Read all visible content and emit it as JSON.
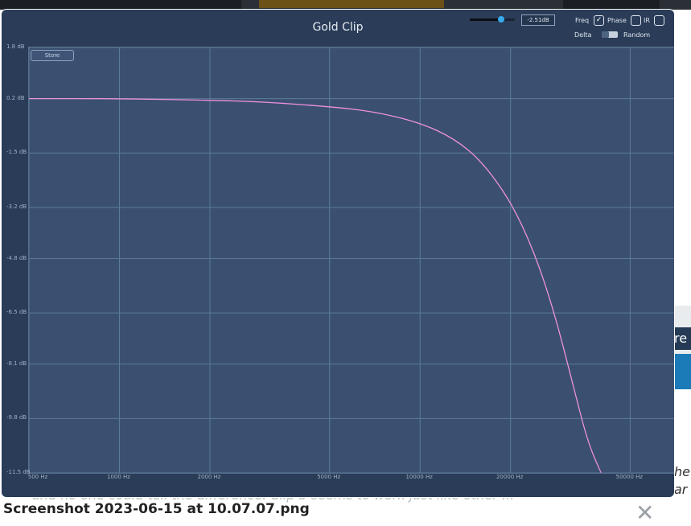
{
  "plugin": {
    "title": "Gold Clip",
    "gain_value": "-2.51dB",
    "store_label": "Store",
    "freq_label": "Freq",
    "freq_checked": true,
    "phase_label": "Phase",
    "phase_checked": false,
    "ir_label": "IR",
    "ir_checked": false,
    "delta_label": "Delta",
    "random_label": "Random",
    "check_glyph": "✓"
  },
  "chart_data": {
    "type": "line",
    "title": "Gold Clip",
    "xscale": "log",
    "xlim": [
      500,
      70000
    ],
    "ylim": [
      -11.5,
      1.8
    ],
    "grid": true,
    "y_tick_labels": [
      "1.8 dB",
      "0.2 dB",
      "-1.5 dB",
      "-3.2 dB",
      "-4.8 dB",
      "-6.5 dB",
      "-8.1 dB",
      "-9.8 dB",
      "-11.5 dB"
    ],
    "y_ticks": [
      1.8,
      0.2,
      -1.5,
      -3.2,
      -4.8,
      -6.5,
      -8.1,
      -9.8,
      -11.5
    ],
    "x_tick_labels": [
      "500 Hz",
      "1000 Hz",
      "2000 Hz",
      "5000 Hz",
      "10000 Hz",
      "20000 Hz",
      "50000 Hz"
    ],
    "x_ticks": [
      500,
      1000,
      2000,
      5000,
      10000,
      20000,
      50000
    ],
    "series": [
      {
        "color": "#ee90e0",
        "x": [
          500,
          1000,
          2000,
          3000,
          5000,
          7000,
          10000,
          13000,
          16000,
          20000,
          24000,
          28000,
          32000,
          36000,
          40000
        ],
        "y": [
          0.2,
          0.2,
          0.15,
          0.1,
          -0.05,
          -0.2,
          -0.55,
          -1.05,
          -1.75,
          -3.0,
          -4.6,
          -6.5,
          -8.6,
          -10.5,
          -11.5
        ]
      }
    ]
  },
  "background": {
    "caption": "Screenshot 2023-06-15 at 10.07.07.png",
    "caption_ghost": "and no one could tell the difference. Clip 3 seems to work just like other ...",
    "right_btn_text": "re",
    "right_text": "he ar",
    "close_glyph": "✕"
  }
}
